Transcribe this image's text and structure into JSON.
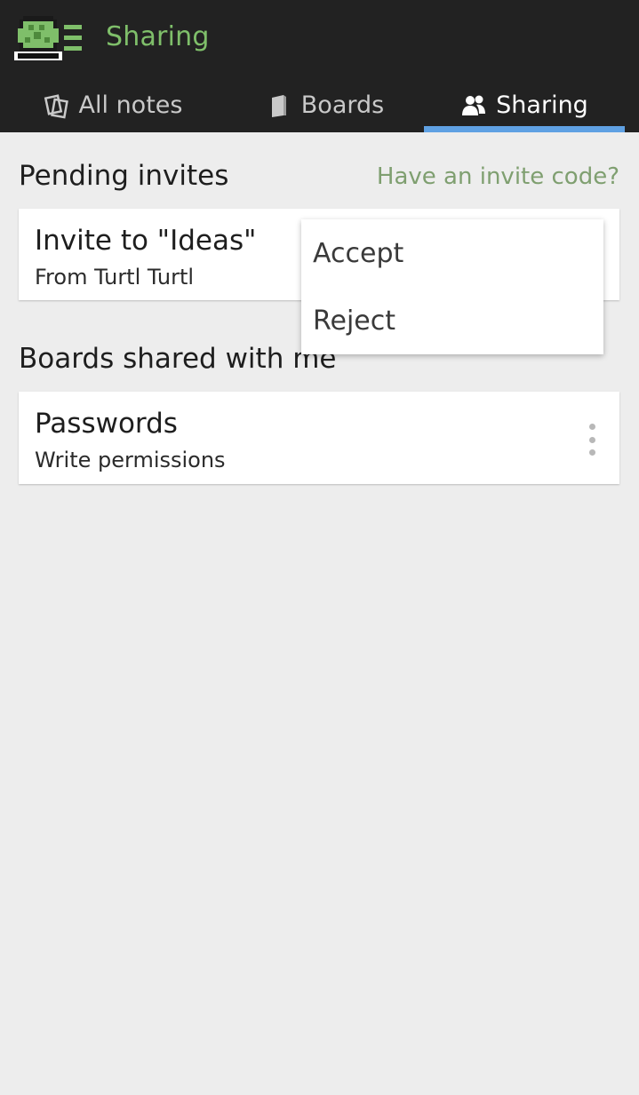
{
  "app": {
    "title": "Sharing"
  },
  "tabs": [
    {
      "label": "All notes",
      "icon": "notes-icon"
    },
    {
      "label": "Boards",
      "icon": "board-icon"
    },
    {
      "label": "Sharing",
      "icon": "people-icon",
      "active": true
    }
  ],
  "pending": {
    "title": "Pending invites",
    "invite_code_link": "Have an invite code?",
    "invites": [
      {
        "title": "Invite to \"Ideas\"",
        "from": "From Turtl Turtl"
      }
    ]
  },
  "menu": {
    "accept": "Accept",
    "reject": "Reject"
  },
  "shared": {
    "title": "Boards shared with me",
    "boards": [
      {
        "name": "Passwords",
        "permissions": "Write permissions"
      }
    ]
  },
  "colors": {
    "header_bg": "#222222",
    "accent_green": "#7fbf6a",
    "tab_underline": "#5fa1e3",
    "link_green": "#7f9f70",
    "page_bg": "#ededed"
  }
}
